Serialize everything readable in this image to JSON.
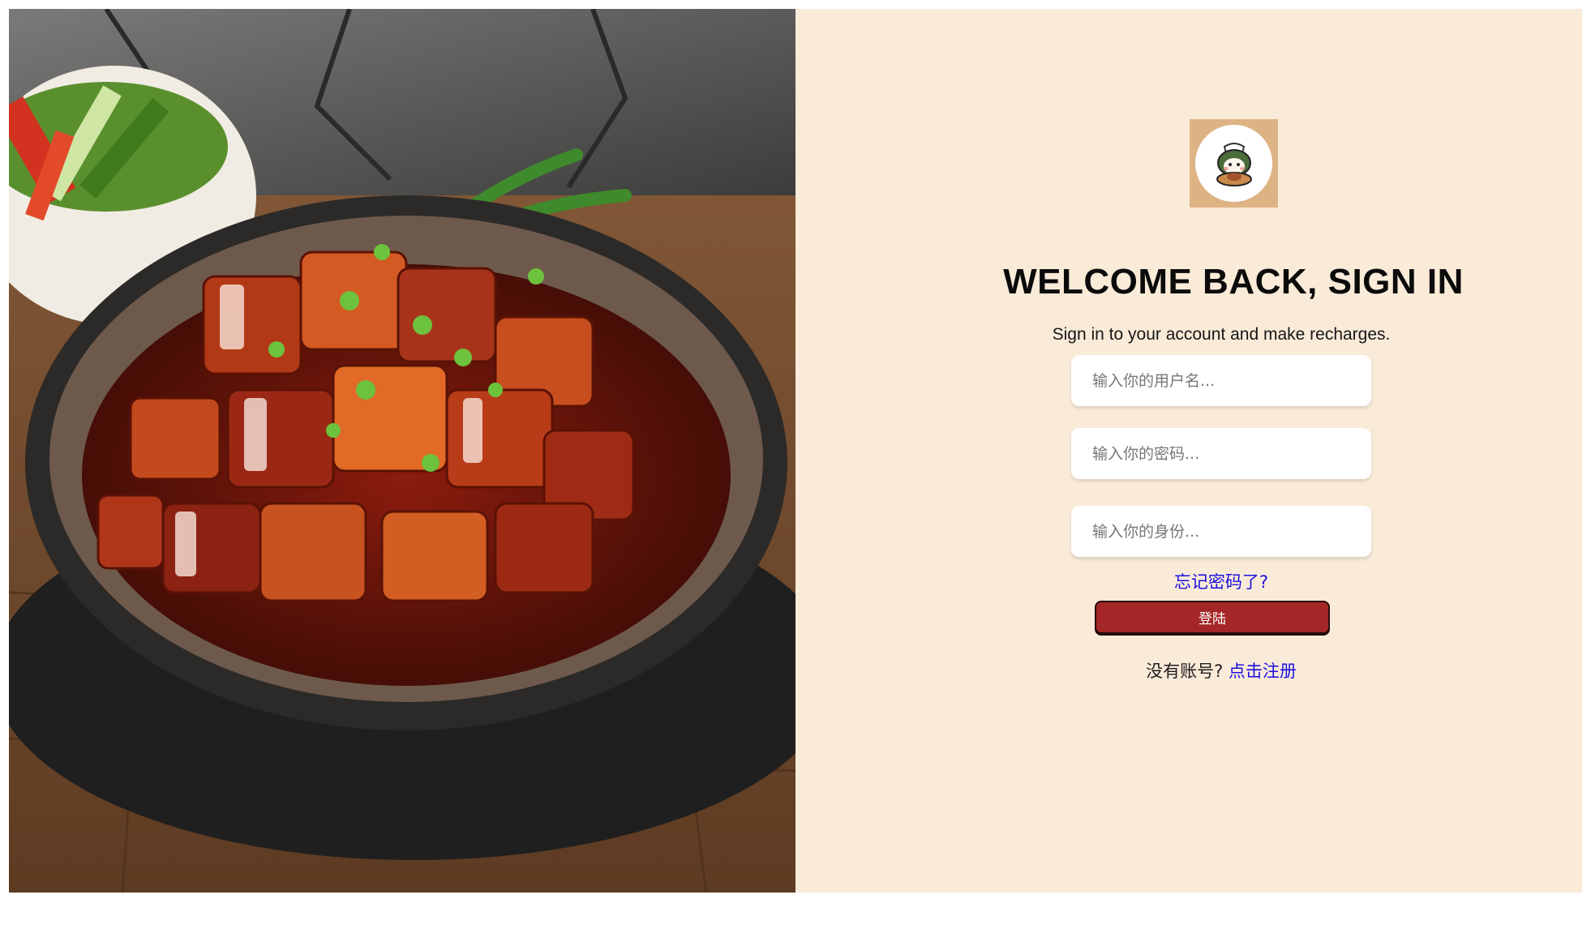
{
  "hero_image": {
    "subject": "braised pork belly in clay bowl with side salad"
  },
  "login": {
    "logo_icon": "chef-cat-mascot-icon",
    "title": "WELCOME BACK, SIGN IN",
    "subtitle": "Sign in to your account and make recharges.",
    "username_placeholder": "输入你的用户名...",
    "password_placeholder": "输入你的密码...",
    "role_placeholder": "输入你的身份...",
    "forgot_label": "忘记密码了?",
    "submit_label": "登陆",
    "no_account_text": "没有账号?",
    "register_link": "点击注册"
  },
  "colors": {
    "panel_bg": "#faebd9",
    "button_bg": "#a52626",
    "link": "#1a10e0",
    "logo_bg": "#deb384"
  }
}
